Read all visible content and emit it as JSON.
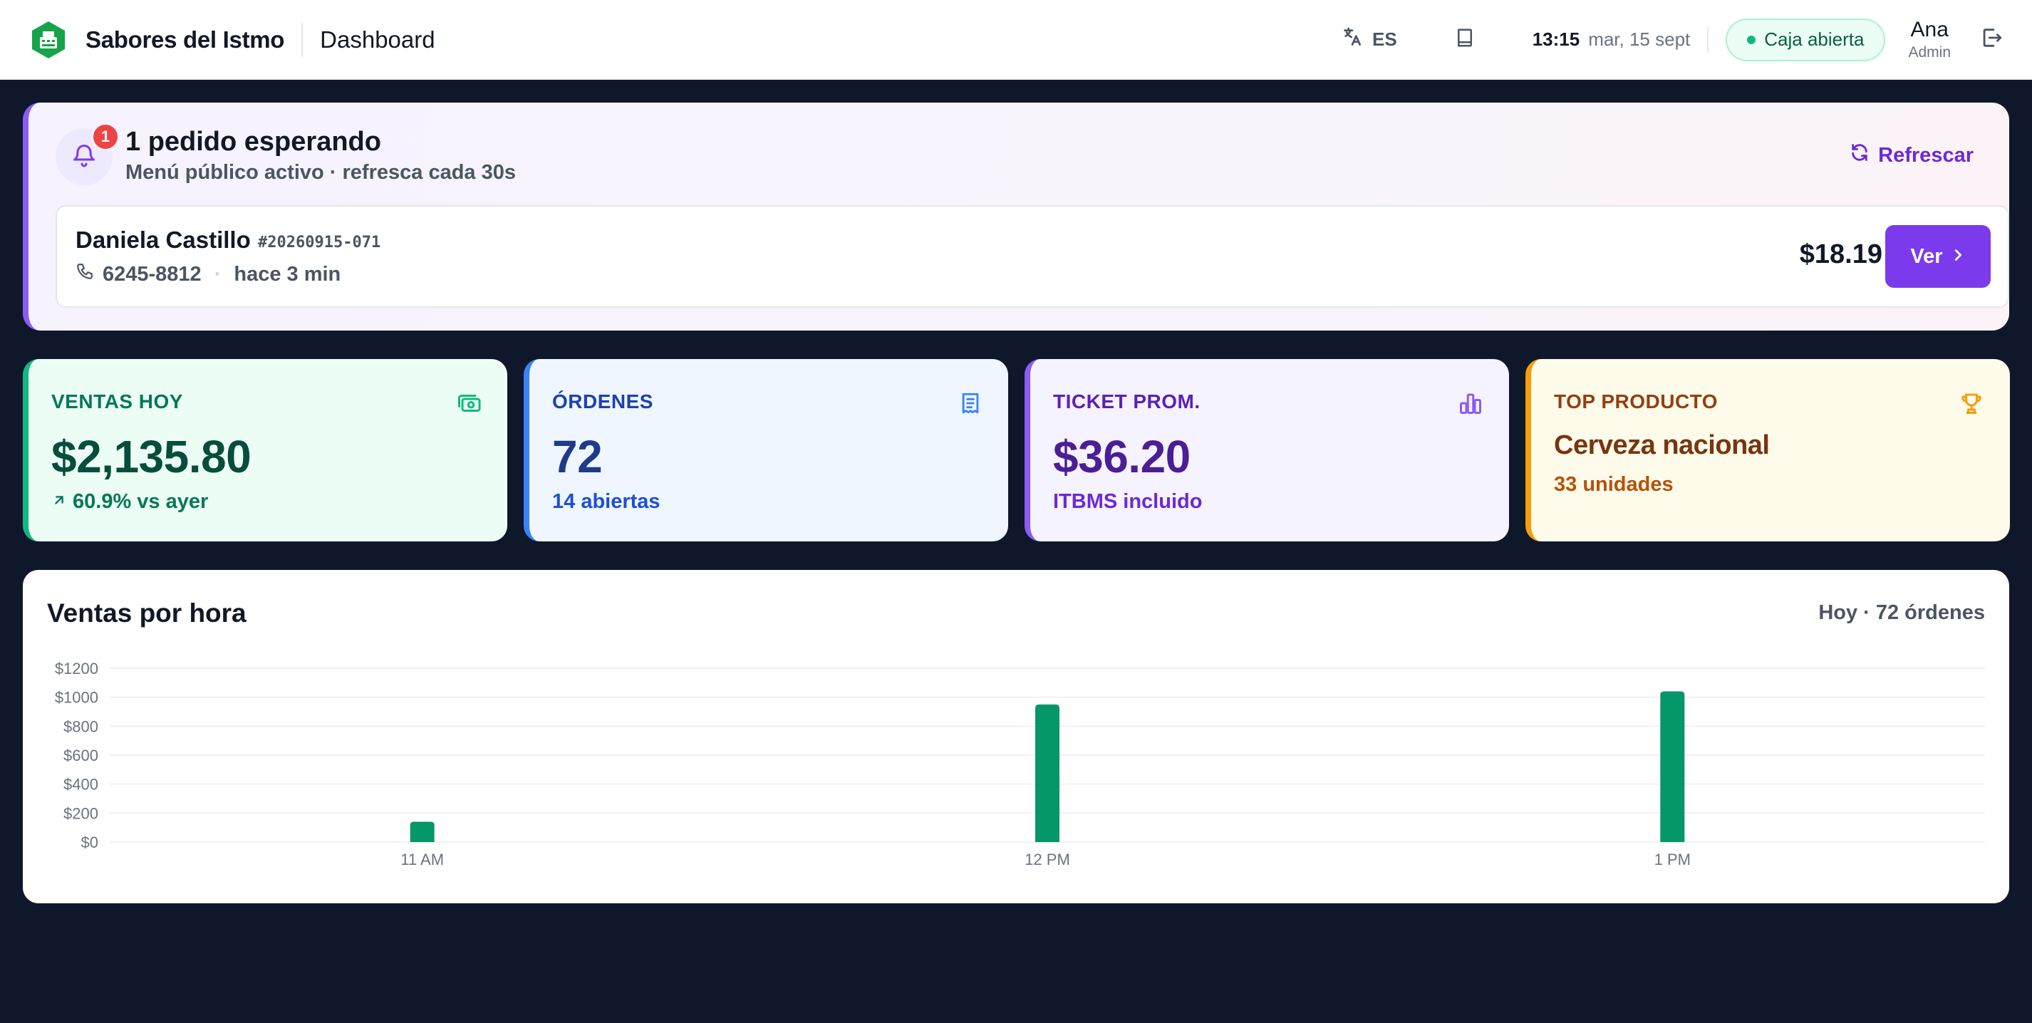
{
  "header": {
    "brand": "Sabores del Istmo",
    "page_title": "Dashboard",
    "language": "ES",
    "time": "13:15",
    "date": "mar, 15 sept",
    "register_status": "Caja abierta",
    "user_name": "Ana",
    "user_role": "Admin",
    "icons": [
      "cash-register-icon",
      "translate-icon",
      "book-icon",
      "logout-icon"
    ]
  },
  "alert": {
    "badge_count": "1",
    "title": "1 pedido esperando",
    "subtitle": "Menú público activo · refresca cada 30s",
    "refresh_label": "Refrescar",
    "order": {
      "customer": "Daniela Castillo",
      "order_id": "#20260915-071",
      "phone": "6245-8812",
      "elapsed": "hace 3 min",
      "total": "$18.19",
      "view_label": "Ver"
    }
  },
  "kpis": {
    "sales": {
      "label": "VENTAS HOY",
      "value": "$2,135.80",
      "sub": "60.9% vs ayer",
      "icon": "cash-icon"
    },
    "orders": {
      "label": "ÓRDENES",
      "value": "72",
      "sub": "14 abiertas",
      "icon": "receipt-icon"
    },
    "ticket": {
      "label": "TICKET PROM.",
      "value": "$36.20",
      "sub": "ITBMS incluido",
      "icon": "bar-chart-icon"
    },
    "top": {
      "label": "TOP PRODUCTO",
      "value": "Cerveza nacional",
      "sub": "33 unidades",
      "icon": "trophy-icon"
    }
  },
  "colors": {
    "accent_purple": "#7c3aed",
    "brand_green": "#16a34a",
    "bar_green": "#059669",
    "background": "#0f172a"
  },
  "chart_panel": {
    "title": "Ventas por hora",
    "meta": "Hoy · 72 órdenes"
  },
  "chart_data": {
    "type": "bar",
    "categories": [
      "11 AM",
      "12 PM",
      "1 PM"
    ],
    "values": [
      140,
      950,
      1040
    ],
    "yticks": [
      0,
      200,
      400,
      600,
      800,
      1000,
      1200
    ],
    "ytick_labels": [
      "$0",
      "$200",
      "$400",
      "$600",
      "$800",
      "$1000",
      "$1200"
    ],
    "ylim": [
      0,
      1200
    ],
    "grid": true
  }
}
